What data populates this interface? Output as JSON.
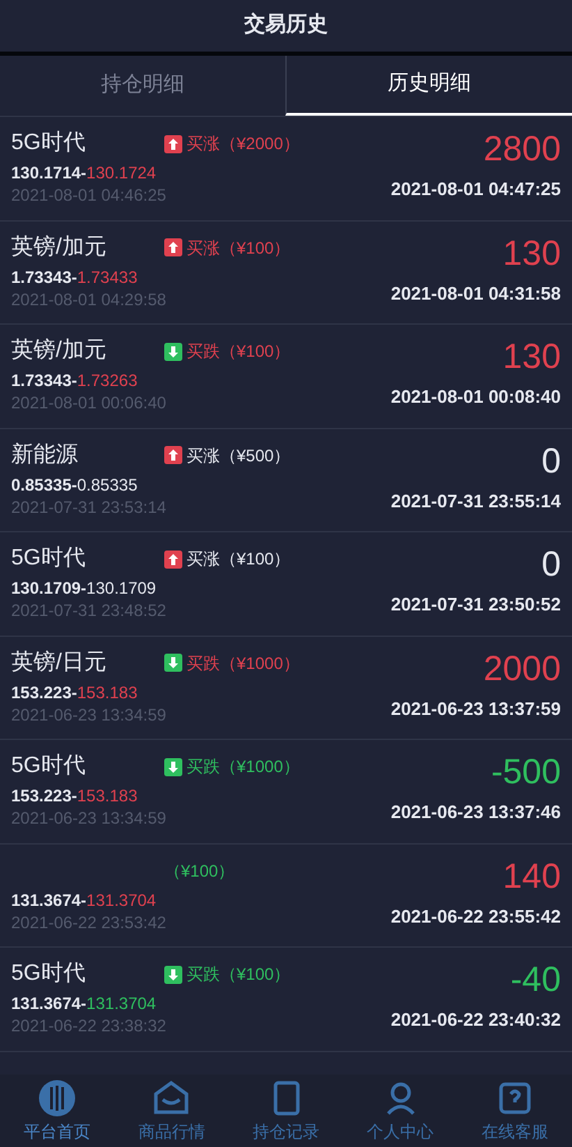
{
  "title": "交易历史",
  "tabs": [
    {
      "label": "持仓明细",
      "selected": false
    },
    {
      "label": "历史明细",
      "selected": true
    }
  ],
  "trades": [
    {
      "name": "5G时代",
      "rising": true,
      "order": {
        "text": "买涨（¥2000）",
        "color": "#e0414f"
      },
      "open": "130.1714-",
      "close": {
        "text": "130.1724",
        "color": "#e0414f"
      },
      "open_time": "2021-08-01 04:46:25",
      "profit": {
        "text": "2800",
        "color": "#e0414f"
      },
      "close_time": "2021-08-01 04:47:25"
    },
    {
      "name": "英镑/加元",
      "rising": true,
      "order": {
        "text": "买涨（¥100）",
        "color": "#e0414f"
      },
      "open": "1.73343-",
      "close": {
        "text": "1.73433",
        "color": "#e0414f"
      },
      "open_time": "2021-08-01 04:29:58",
      "profit": {
        "text": "130",
        "color": "#e0414f"
      },
      "close_time": "2021-08-01 04:31:58"
    },
    {
      "name": "英镑/加元",
      "rising": false,
      "order": {
        "text": "买跌（¥100）",
        "color": "#e0414f"
      },
      "open": "1.73343-",
      "close": {
        "text": "1.73263",
        "color": "#e0414f"
      },
      "open_time": "2021-08-01 00:06:40",
      "profit": {
        "text": "130",
        "color": "#e0414f"
      },
      "close_time": "2021-08-01 00:08:40"
    },
    {
      "name": "新能源",
      "rising": true,
      "order": {
        "text": "买涨（¥500）",
        "color": "#e6e8ef"
      },
      "open": "0.85335-",
      "close": {
        "text": "0.85335",
        "color": "#e6e8ef"
      },
      "open_time": "2021-07-31 23:53:14",
      "profit": {
        "text": "0",
        "color": "#e6e8ef"
      },
      "close_time": "2021-07-31 23:55:14"
    },
    {
      "name": "5G时代",
      "rising": true,
      "order": {
        "text": "买涨（¥100）",
        "color": "#e6e8ef"
      },
      "open": "130.1709-",
      "close": {
        "text": "130.1709",
        "color": "#e6e8ef"
      },
      "open_time": "2021-07-31 23:48:52",
      "profit": {
        "text": "0",
        "color": "#e6e8ef"
      },
      "close_time": "2021-07-31 23:50:52"
    },
    {
      "name": "英镑/日元",
      "rising": false,
      "order": {
        "text": "买跌（¥1000）",
        "color": "#e0414f"
      },
      "open": "153.223-",
      "close": {
        "text": "153.183",
        "color": "#e0414f"
      },
      "open_time": "2021-06-23 13:34:59",
      "profit": {
        "text": "2000",
        "color": "#e0414f"
      },
      "close_time": "2021-06-23 13:37:59"
    },
    {
      "name": "5G时代",
      "rising": false,
      "order": {
        "text": "买跌（¥1000）",
        "color": "#2fbf5f"
      },
      "open": "153.223-",
      "close": {
        "text": "153.183",
        "color": "#e0414f"
      },
      "open_time": "2021-06-23 13:34:59",
      "profit": {
        "text": "-500",
        "color": "#2fbf5f"
      },
      "close_time": "2021-06-23 13:37:46"
    },
    {
      "order": {
        "text": "（¥100）",
        "color": "#2fbf5f"
      },
      "open": "131.3674-",
      "close": {
        "text": "131.3704",
        "color": "#e0414f"
      },
      "open_time": "2021-06-22 23:53:42",
      "profit": {
        "text": "140",
        "color": "#e0414f"
      },
      "close_time": "2021-06-22 23:55:42"
    },
    {
      "name": "5G时代",
      "rising": false,
      "order": {
        "text": "买跌（¥100）",
        "color": "#2fbf5f"
      },
      "open": "131.3674-",
      "close": {
        "text": "131.3704",
        "color": "#2fbf5f"
      },
      "open_time": "2021-06-22 23:38:32",
      "profit": {
        "text": "-40",
        "color": "#2fbf5f"
      },
      "close_time": "2021-06-22 23:40:32"
    }
  ],
  "nav": [
    {
      "label": "平台首页",
      "kind": "home",
      "selected": true
    },
    {
      "label": "商品行情",
      "kind": "market",
      "selected": false
    },
    {
      "label": "持仓记录",
      "kind": "orders",
      "selected": false
    },
    {
      "label": "个人中心",
      "kind": "user",
      "selected": false
    },
    {
      "label": "在线客服",
      "kind": "help",
      "selected": false
    }
  ]
}
